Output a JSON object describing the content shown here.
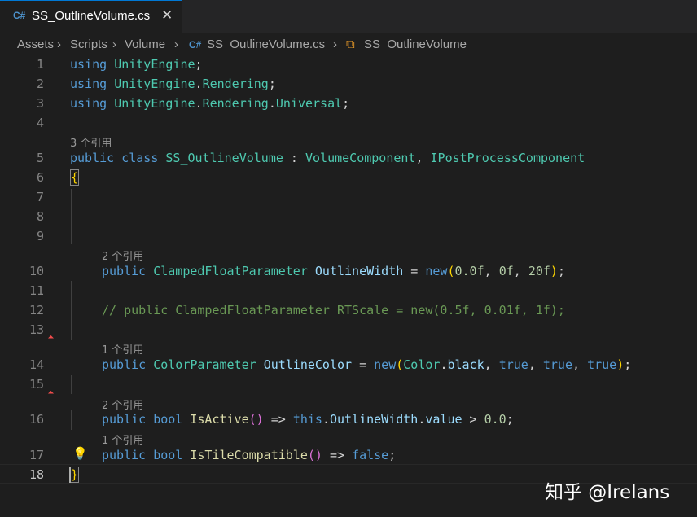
{
  "tab": {
    "icon": "C#",
    "title": "SS_OutlineVolume.cs",
    "close": "✕"
  },
  "breadcrumb": {
    "items": [
      "Assets",
      "Scripts",
      "Volume",
      "SS_OutlineVolume.cs",
      "SS_OutlineVolume"
    ],
    "separator": "›",
    "file_icon": "C#",
    "class_icon": "⧉"
  },
  "editor": {
    "line_numbers": [
      "1",
      "2",
      "3",
      "4",
      "5",
      "6",
      "7",
      "8",
      "9",
      "10",
      "11",
      "12",
      "13",
      "14",
      "15",
      "16",
      "17",
      "18"
    ],
    "code_lens": {
      "class": "3 个引用",
      "outline_width": "2 个引用",
      "outline_color": "1 个引用",
      "is_active": "2 个引用",
      "is_tile_compatible": "1 个引用"
    },
    "lines": {
      "l1": [
        "using",
        " ",
        "UnityEngine",
        ";"
      ],
      "l2": [
        "using",
        " ",
        "UnityEngine",
        ".",
        "Rendering",
        ";"
      ],
      "l3": [
        "using",
        " ",
        "UnityEngine",
        ".",
        "Rendering",
        ".",
        "Universal",
        ";"
      ],
      "l5": [
        "public",
        " ",
        "class",
        " ",
        "SS_OutlineVolume",
        " : ",
        "VolumeComponent",
        ", ",
        "IPostProcessComponent"
      ],
      "l6": [
        "{"
      ],
      "l10": [
        "public",
        " ",
        "ClampedFloatParameter",
        " ",
        "OutlineWidth",
        " = ",
        "new",
        "(",
        "0.0f",
        ", ",
        "0f",
        ", ",
        "20f",
        ")",
        ";"
      ],
      "l12": [
        "// public ClampedFloatParameter RTScale = new(0.5f, 0.01f, 1f);"
      ],
      "l14": [
        "public",
        " ",
        "ColorParameter",
        " ",
        "OutlineColor",
        " = ",
        "new",
        "(",
        "Color",
        ".",
        "black",
        ", ",
        "true",
        ", ",
        "true",
        ", ",
        "true",
        ")",
        ";"
      ],
      "l16": [
        "public",
        " ",
        "bool",
        " ",
        "IsActive",
        "()",
        " => ",
        "this",
        ".",
        "OutlineWidth",
        ".",
        "value",
        " > ",
        "0.0",
        ";"
      ],
      "l17": [
        "public",
        " ",
        "bool",
        " ",
        "IsTileCompatible",
        "()",
        " => ",
        "false",
        ";"
      ],
      "l18": [
        "}"
      ]
    },
    "lightbulb_icon": "💡"
  },
  "watermark": "知乎 @Irelans",
  "colors": {
    "background": "#1e1e1e",
    "keyword": "#569cd6",
    "type": "#4ec9b0",
    "function": "#dcdcaa",
    "variable": "#9cdcfe",
    "number": "#b5cea8",
    "comment": "#6a9955",
    "bracket": "#ffd700"
  }
}
